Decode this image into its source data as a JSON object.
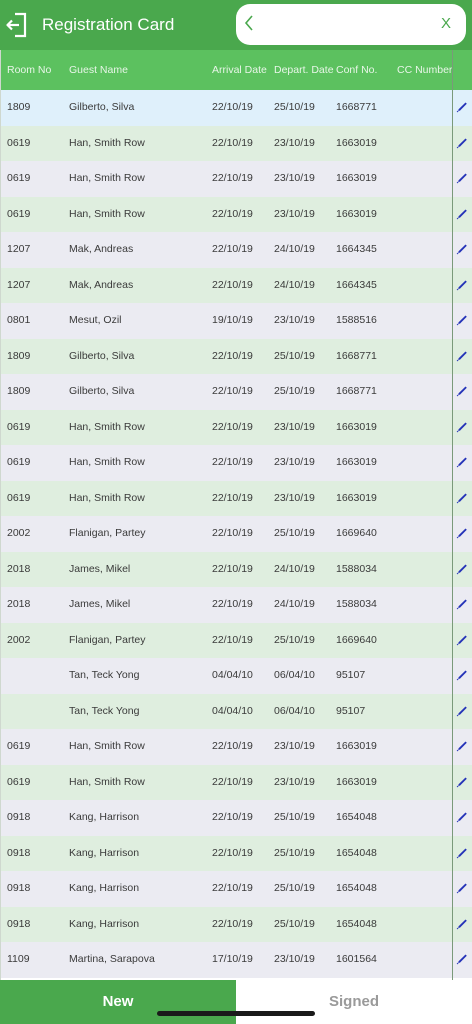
{
  "header": {
    "title": "Registration Card",
    "exit_icon": "exit-door-icon"
  },
  "search": {
    "value": "",
    "placeholder": "",
    "back_icon": "chevron-left-icon",
    "clear_label": "X"
  },
  "columns": [
    "Room No",
    "Guest Name",
    "Arrival Date",
    "Depart. Date",
    "Conf No.",
    "CC Number"
  ],
  "rows": [
    {
      "room": "1809",
      "guest": "Gilberto, Silva",
      "arrival": "22/10/19",
      "depart": "25/10/19",
      "conf": "1668771",
      "cc": ""
    },
    {
      "room": "0619",
      "guest": "Han, Smith Row",
      "arrival": "22/10/19",
      "depart": "23/10/19",
      "conf": "1663019",
      "cc": ""
    },
    {
      "room": "0619",
      "guest": "Han, Smith Row",
      "arrival": "22/10/19",
      "depart": "23/10/19",
      "conf": "1663019",
      "cc": ""
    },
    {
      "room": "0619",
      "guest": "Han, Smith Row",
      "arrival": "22/10/19",
      "depart": "23/10/19",
      "conf": "1663019",
      "cc": ""
    },
    {
      "room": "1207",
      "guest": "Mak, Andreas",
      "arrival": "22/10/19",
      "depart": "24/10/19",
      "conf": "1664345",
      "cc": ""
    },
    {
      "room": "1207",
      "guest": "Mak, Andreas",
      "arrival": "22/10/19",
      "depart": "24/10/19",
      "conf": "1664345",
      "cc": ""
    },
    {
      "room": "0801",
      "guest": "Mesut, Ozil",
      "arrival": "19/10/19",
      "depart": "23/10/19",
      "conf": "1588516",
      "cc": ""
    },
    {
      "room": "1809",
      "guest": "Gilberto, Silva",
      "arrival": "22/10/19",
      "depart": "25/10/19",
      "conf": "1668771",
      "cc": ""
    },
    {
      "room": "1809",
      "guest": "Gilberto, Silva",
      "arrival": "22/10/19",
      "depart": "25/10/19",
      "conf": "1668771",
      "cc": ""
    },
    {
      "room": "0619",
      "guest": "Han, Smith Row",
      "arrival": "22/10/19",
      "depart": "23/10/19",
      "conf": "1663019",
      "cc": ""
    },
    {
      "room": "0619",
      "guest": "Han, Smith Row",
      "arrival": "22/10/19",
      "depart": "23/10/19",
      "conf": "1663019",
      "cc": ""
    },
    {
      "room": "0619",
      "guest": "Han, Smith Row",
      "arrival": "22/10/19",
      "depart": "23/10/19",
      "conf": "1663019",
      "cc": ""
    },
    {
      "room": "2002",
      "guest": "Flanigan, Partey",
      "arrival": "22/10/19",
      "depart": "25/10/19",
      "conf": "1669640",
      "cc": ""
    },
    {
      "room": "2018",
      "guest": "James, Mikel",
      "arrival": "22/10/19",
      "depart": "24/10/19",
      "conf": "1588034",
      "cc": ""
    },
    {
      "room": "2018",
      "guest": "James, Mikel",
      "arrival": "22/10/19",
      "depart": "24/10/19",
      "conf": "1588034",
      "cc": ""
    },
    {
      "room": "2002",
      "guest": "Flanigan, Partey",
      "arrival": "22/10/19",
      "depart": "25/10/19",
      "conf": "1669640",
      "cc": ""
    },
    {
      "room": "",
      "guest": "Tan, Teck Yong",
      "arrival": "04/04/10",
      "depart": "06/04/10",
      "conf": "95107",
      "cc": ""
    },
    {
      "room": "",
      "guest": "Tan, Teck Yong",
      "arrival": "04/04/10",
      "depart": "06/04/10",
      "conf": "95107",
      "cc": ""
    },
    {
      "room": "0619",
      "guest": "Han, Smith Row",
      "arrival": "22/10/19",
      "depart": "23/10/19",
      "conf": "1663019",
      "cc": ""
    },
    {
      "room": "0619",
      "guest": "Han, Smith Row",
      "arrival": "22/10/19",
      "depart": "23/10/19",
      "conf": "1663019",
      "cc": ""
    },
    {
      "room": "0918",
      "guest": "Kang, Harrison",
      "arrival": "22/10/19",
      "depart": "25/10/19",
      "conf": "1654048",
      "cc": ""
    },
    {
      "room": "0918",
      "guest": "Kang, Harrison",
      "arrival": "22/10/19",
      "depart": "25/10/19",
      "conf": "1654048",
      "cc": ""
    },
    {
      "room": "0918",
      "guest": "Kang, Harrison",
      "arrival": "22/10/19",
      "depart": "25/10/19",
      "conf": "1654048",
      "cc": ""
    },
    {
      "room": "0918",
      "guest": "Kang, Harrison",
      "arrival": "22/10/19",
      "depart": "25/10/19",
      "conf": "1654048",
      "cc": ""
    },
    {
      "room": "1109",
      "guest": "Martina, Sarapova",
      "arrival": "17/10/19",
      "depart": "23/10/19",
      "conf": "1601564",
      "cc": ""
    }
  ],
  "row_action_icon": "pen-icon",
  "footer": {
    "new_label": "New",
    "signed_label": "Signed"
  },
  "colors": {
    "header": "#4aa84d",
    "column_header": "#5cc15f",
    "row_green": "#dfeedf",
    "row_grey": "#ebebf2",
    "row_selected": "#dff0fb",
    "pen": "#2533b8"
  }
}
